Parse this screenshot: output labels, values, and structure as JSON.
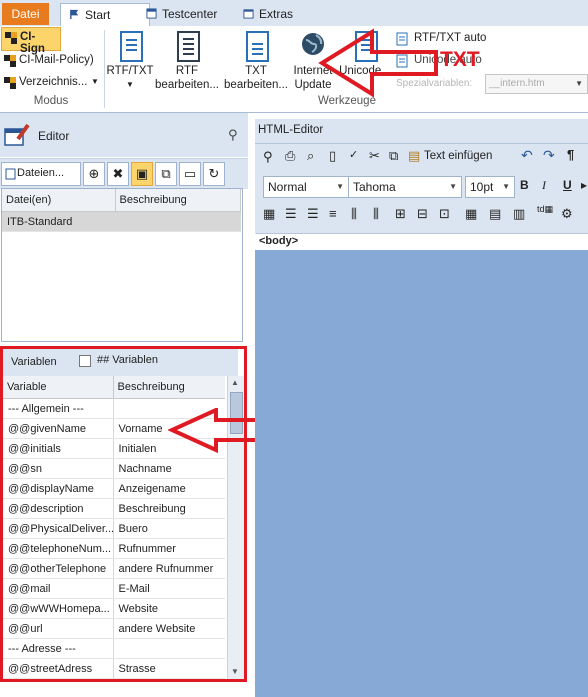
{
  "menu_tabs": {
    "file": "Datei",
    "start": "Start",
    "testcenter": "Testcenter",
    "extras": "Extras"
  },
  "ribbon": {
    "ci_sign": "CI-Sign",
    "ci_mail_policy": "CI-Mail-Policy)",
    "verzeichnis": "Verzeichnis...",
    "modus_label": "Modus",
    "rtf_txt": "RTF/TXT",
    "rtf_bearbeiten_1": "RTF",
    "rtf_bearbeiten_2": "bearbeiten...",
    "txt_bearbeiten_1": "TXT",
    "txt_bearbeiten_2": "bearbeiten...",
    "internet_1": "Internet",
    "internet_2": "Update",
    "unicode": "Unicode...",
    "rtf_txt_auto": "RTF/TXT auto",
    "unicode_auto": "Unicode auto",
    "spezialvariablen_label": "Spezialvariablen:",
    "spezialvariablen_value": "__intern.htm",
    "werkzeuge_label": "Werkzeuge",
    "annotation_txt": "TXT"
  },
  "editor": {
    "title": "Editor",
    "files_button": "Dateien...",
    "files_columns": [
      "Datei(en)",
      "Beschreibung"
    ],
    "files_rows": [
      [
        "ITB-Standard",
        ""
      ]
    ]
  },
  "variables": {
    "tab_label": "Variablen",
    "hash_label": "## Variablen",
    "columns": [
      "Variable",
      "Beschreibung"
    ],
    "rows": [
      [
        "--- Allgemein ---",
        ""
      ],
      [
        "@@givenName",
        "Vorname"
      ],
      [
        "@@initials",
        "Initialen"
      ],
      [
        "@@sn",
        "Nachname"
      ],
      [
        "@@displayName",
        "Anzeigename"
      ],
      [
        "@@description",
        "Beschreibung"
      ],
      [
        "@@PhysicalDeliver...",
        "Buero"
      ],
      [
        "@@telephoneNum...",
        "Rufnummer"
      ],
      [
        "@@otherTelephone",
        "andere Rufnummer"
      ],
      [
        "@@mail",
        "E-Mail"
      ],
      [
        "@@wWWHomepa...",
        "Website"
      ],
      [
        "@@url",
        "andere Website"
      ],
      [
        "--- Adresse ---",
        ""
      ],
      [
        "@@streetAdress",
        "Strasse"
      ]
    ]
  },
  "html_editor": {
    "title": "HTML-Editor",
    "paste_text": "Text einfügen",
    "style_select": "Normal",
    "font_select": "Tahoma",
    "size_select": "10pt",
    "body_tag": "<body>"
  },
  "colors": {
    "file_tab": "#e87b1e",
    "annotation_red": "#e01a22",
    "canvas": "#86a9d6"
  }
}
